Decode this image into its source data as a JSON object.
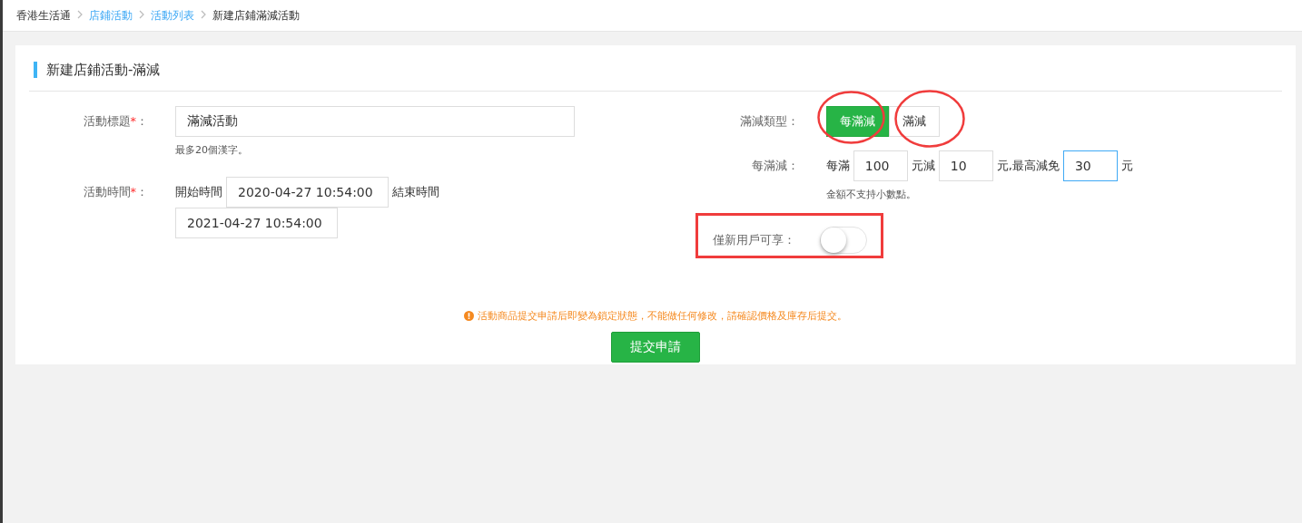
{
  "breadcrumb": [
    {
      "label": "香港生活通",
      "link": false
    },
    {
      "label": "店鋪活動",
      "link": true
    },
    {
      "label": "活動列表",
      "link": true
    },
    {
      "label": "新建店鋪滿減活動",
      "link": false
    }
  ],
  "card": {
    "title": "新建店鋪活動-滿減"
  },
  "title_field": {
    "label": "活動標題",
    "required": "*",
    "colon": "：",
    "value": "滿減活動",
    "hint": "最多20個漢字。"
  },
  "time_field": {
    "label": "活動時間",
    "required": "*",
    "colon": "：",
    "start_label": "開始時間",
    "start_value": "2020-04-27 10:54:00",
    "end_label": "結束時間",
    "end_value": "2021-04-27 10:54:00"
  },
  "type_field": {
    "label": "滿減類型",
    "colon": "：",
    "options": [
      {
        "label": "每滿減",
        "selected": true
      },
      {
        "label": "滿減",
        "selected": false
      }
    ]
  },
  "rule_field": {
    "label": "每滿減",
    "colon": "：",
    "parts": [
      {
        "text": "每滿",
        "value": "100",
        "focused": false
      },
      {
        "text": "元減",
        "value": "10",
        "focused": false
      },
      {
        "text": "元,最高減免",
        "value": "30",
        "focused": true
      }
    ],
    "suffix": "元",
    "hint": "金額不支持小數點。"
  },
  "new_user_field": {
    "label": "僅新用戶可享",
    "colon": "：",
    "on": false
  },
  "warning": "活動商品提交申請后即變為鎖定狀態，不能做任何修改，請確認價格及庫存后提交。",
  "submit": "提交申請"
}
